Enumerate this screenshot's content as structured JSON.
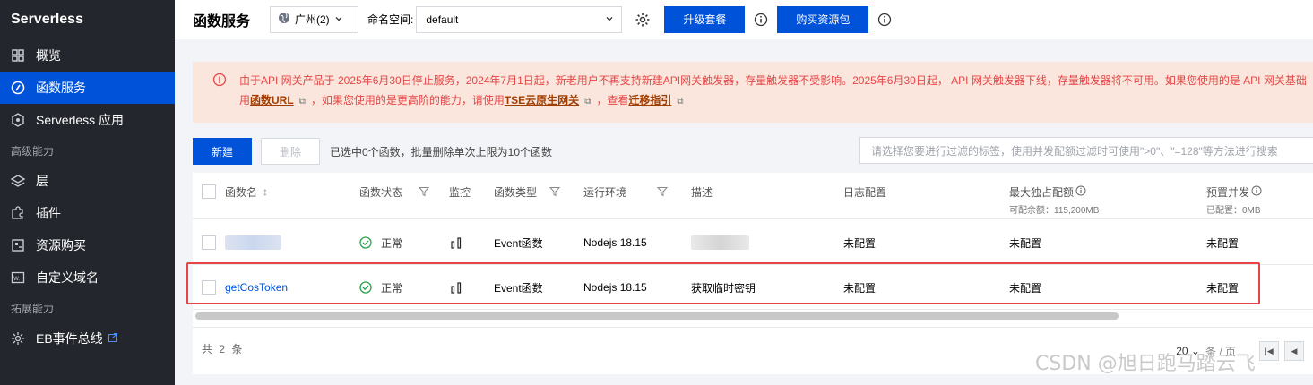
{
  "sidebar": {
    "brand": "Serverless",
    "items": [
      {
        "label": "概览"
      },
      {
        "label": "函数服务"
      },
      {
        "label": "Serverless 应用"
      }
    ],
    "group_advanced": "高级能力",
    "advanced_items": [
      {
        "label": "层"
      },
      {
        "label": "插件"
      },
      {
        "label": "资源购买"
      },
      {
        "label": "自定义域名"
      }
    ],
    "group_extend": "拓展能力",
    "extend_items": [
      {
        "label": "EB事件总线"
      }
    ]
  },
  "header": {
    "title": "函数服务",
    "region": "广州(2)",
    "namespace_label": "命名空间:",
    "namespace_value": "default",
    "upgrade_label": "升级套餐",
    "buy_label": "购买资源包"
  },
  "notice": {
    "line1": "由于API 网关产品于 2025年6月30日停止服务，2024年7月1日起，新老用户不再支持新建API网关触发器，存量触发器不受影响。2025年6月30日起，  API 网关触发器下线，存量触发器将不可用。如果您使用的是 API 网关基础",
    "p2_prefix": "用",
    "link1": "函数URL",
    "p2_mid": "，如果您使用的是更高阶的能力，请使用",
    "link2": "TSE云原生网关",
    "p2_mid2": "，查看",
    "link3": "迁移指引"
  },
  "toolbar": {
    "new_label": "新建",
    "delete_label": "删除",
    "selection_info": "已选中0个函数，批量删除单次上限为10个函数",
    "filter_placeholder": "请选择您要进行过滤的标签，使用并发配额过滤时可使用\">0\"、\"=128\"等方法进行搜索"
  },
  "table": {
    "headers": {
      "name": "函数名",
      "status": "函数状态",
      "monitor": "监控",
      "type": "函数类型",
      "runtime": "运行环境",
      "desc": "描述",
      "log": "日志配置",
      "max_quota": "最大独占配额",
      "max_quota_sub": "可配余额：115,200MB",
      "prov": "预置并发",
      "prov_sub": "已配置：0MB"
    },
    "rows": [
      {
        "name": "",
        "status": "正常",
        "type": "Event函数",
        "runtime": "Nodejs 18.15",
        "desc": "",
        "log": "未配置",
        "quota": "未配置",
        "prov": "未配置"
      },
      {
        "name": "getCosToken",
        "status": "正常",
        "type": "Event函数",
        "runtime": "Nodejs 18.15",
        "desc": "获取临时密钥",
        "log": "未配置",
        "quota": "未配置",
        "prov": "未配置"
      }
    ],
    "total": "共 2 条",
    "page_size": "20",
    "page_size_unit": "条 / 页"
  },
  "watermark": "CSDN @旭日跑马踏云飞",
  "colors": {
    "primary": "#0052d9",
    "sidebar_bg": "#23262d",
    "notice_bg": "#fbe6dd",
    "notice_text": "#e54545",
    "ok": "#29a148",
    "highlight": "#e54545"
  }
}
